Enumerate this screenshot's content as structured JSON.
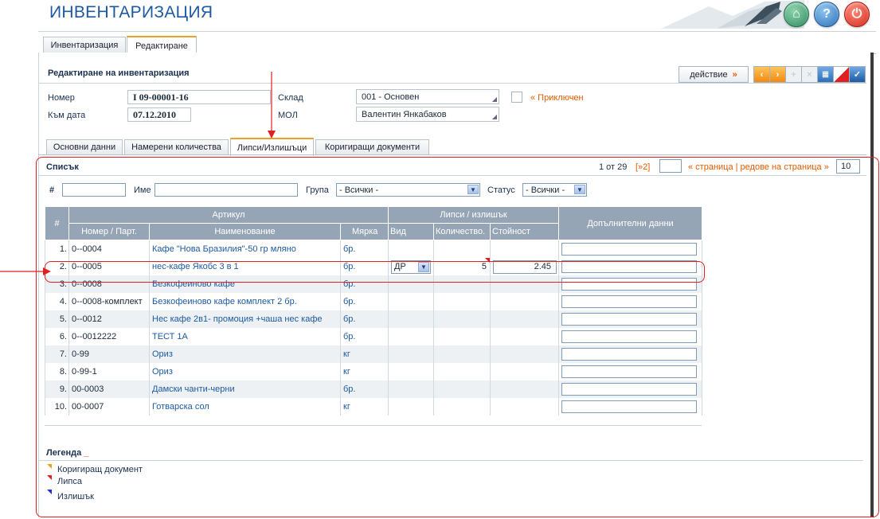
{
  "app": {
    "title": "ИНВЕНТАРИЗАЦИЯ"
  },
  "header_buttons": {
    "home": "⌂",
    "help": "?",
    "power": "⏻"
  },
  "top_tabs": [
    {
      "label": "Инвентаризация",
      "active": false
    },
    {
      "label": "Редактиране",
      "active": true
    }
  ],
  "edit": {
    "title": "Редактиране на инвентаризация",
    "action_label": "действие",
    "action_arrow": "»",
    "fields": {
      "number_label": "Номер",
      "number_value": "I 09-00001-16",
      "date_label": "Към дата",
      "date_value": "07.12.2010",
      "warehouse_label": "Склад",
      "warehouse_value": "001 - Основен",
      "mol_label": "МОЛ",
      "mol_value": "Валентин Янкабаков",
      "closed_label": "« Приключен"
    }
  },
  "sub_tabs": [
    {
      "label": "Основни данни",
      "active": false
    },
    {
      "label": "Намерени количества",
      "active": false
    },
    {
      "label": "Липси/Излишъци",
      "active": true
    },
    {
      "label": "Коригиращи документи",
      "active": false
    }
  ],
  "list": {
    "title": "Списък",
    "pager_info": "1 от 29",
    "pager_next": "[»2]",
    "page_label": "« страница | редове на страница »",
    "rows_per_page": "10",
    "filters": {
      "num_label": "#",
      "name_label": "Име",
      "group_label": "Група",
      "group_value": "- Всички -",
      "status_label": "Статус",
      "status_value": "- Всички -"
    }
  },
  "table": {
    "headers": {
      "num": "#",
      "article": "Артикул",
      "number_part": "Номер / Парт.",
      "name": "Наименование",
      "unit": "Мярка",
      "shortage_surplus": "Липси / излишък",
      "kind": "Вид",
      "quantity": "Количество.",
      "value": "Стойност",
      "extra": "Допълнителни данни"
    },
    "rows": [
      {
        "n": "1.",
        "code": "0--0004",
        "name": "Кафе \"Нова Бразилия\"-50 гр мляно",
        "unit": "бр.",
        "kind": "",
        "qty": "",
        "value": ""
      },
      {
        "n": "2.",
        "code": "0--0005",
        "name": "нес-кафе Якобс 3 в 1",
        "unit": "бр.",
        "kind": "ДР",
        "qty": "5",
        "value": "2.45"
      },
      {
        "n": "3.",
        "code": "0--0008",
        "name": "Безкофеиново кафе",
        "unit": "бр.",
        "kind": "",
        "qty": "",
        "value": ""
      },
      {
        "n": "4.",
        "code": "0--0008-комплект",
        "name": "Безкофеиново кафе комплект 2 бр.",
        "unit": "бр.",
        "kind": "",
        "qty": "",
        "value": ""
      },
      {
        "n": "5.",
        "code": "0--0012",
        "name": "Нес кафе 2в1- промоция +чаша нес кафе",
        "unit": "бр.",
        "kind": "",
        "qty": "",
        "value": ""
      },
      {
        "n": "6.",
        "code": "0--0012222",
        "name": "ТЕСТ 1А",
        "unit": "бр.",
        "kind": "",
        "qty": "",
        "value": ""
      },
      {
        "n": "7.",
        "code": "0-99",
        "name": "Ориз",
        "unit": "кг",
        "kind": "",
        "qty": "",
        "value": ""
      },
      {
        "n": "8.",
        "code": "0-99-1",
        "name": "Ориз",
        "unit": "кг",
        "kind": "",
        "qty": "",
        "value": ""
      },
      {
        "n": "9.",
        "code": "00-0003",
        "name": "Дамски чанти-черни",
        "unit": "бр.",
        "kind": "",
        "qty": "",
        "value": ""
      },
      {
        "n": "10.",
        "code": "00-0007",
        "name": "Готварска сол",
        "unit": "кг",
        "kind": "",
        "qty": "",
        "value": ""
      }
    ]
  },
  "legend": {
    "title": "Легенда",
    "toggle": "_",
    "items": [
      {
        "label": "Коригиращ документ",
        "color": "#f0a020"
      },
      {
        "label": "Липса",
        "color": "#e02020"
      },
      {
        "label": "Излишък",
        "color": "#2030d0"
      }
    ]
  },
  "colors": {
    "accent": "#1d5aa0",
    "header_grid": "#95a5b5",
    "annotation": "#e02020",
    "tab_active": "#f0a020"
  }
}
